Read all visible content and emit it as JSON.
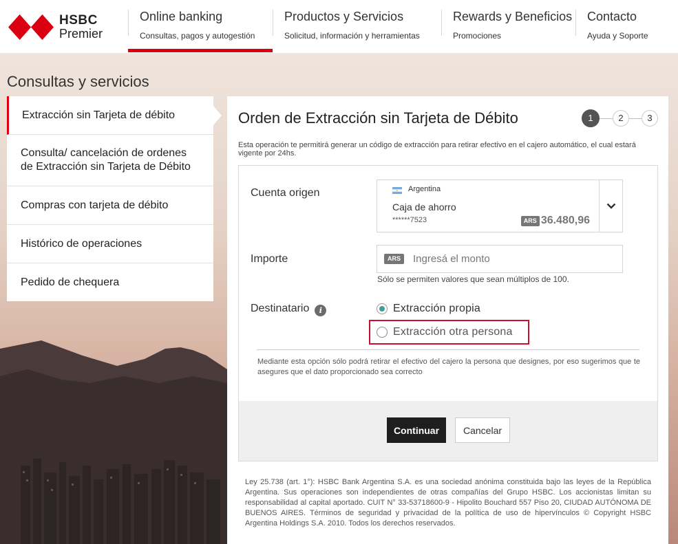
{
  "brand": {
    "name": "HSBC",
    "tier": "Premier"
  },
  "nav": [
    {
      "title": "Online banking",
      "subtitle": "Consultas, pagos y autogestión"
    },
    {
      "title": "Productos y Servicios",
      "subtitle": "Solicitud, información y herramientas"
    },
    {
      "title": "Rewards y Beneficios",
      "subtitle": "Promociones"
    },
    {
      "title": "Contacto",
      "subtitle": "Ayuda y Soporte"
    }
  ],
  "page_title": "Consultas y servicios",
  "sidebar": {
    "items": [
      {
        "label": "Extracción sin Tarjeta de débito"
      },
      {
        "label": "Consulta/ cancelación de ordenes de Extracción sin Tarjeta de Débito"
      },
      {
        "label": "Compras con tarjeta de débito"
      },
      {
        "label": "Histórico de operaciones"
      },
      {
        "label": "Pedido de chequera"
      }
    ]
  },
  "form": {
    "title": "Orden de Extracción sin Tarjeta de Débito",
    "steps": [
      "1",
      "2",
      "3"
    ],
    "intro": "Esta operación te permitirá generar un código de extracción para retirar efectivo en el cajero automático, el cual estará vigente por 24hs.",
    "account": {
      "label": "Cuenta origen",
      "country": "Argentina",
      "type": "Caja de ahorro",
      "number": "******7523",
      "currency": "ARS",
      "balance": "36.480,96"
    },
    "amount": {
      "label": "Importe",
      "currency": "ARS",
      "placeholder": "Ingresá el monto",
      "hint": "Sólo se permiten valores que sean múltiplos de 100."
    },
    "recipient": {
      "label": "Destinatario",
      "option_own": "Extracción propia",
      "option_other": "Extracción otra persona",
      "note": "Mediante esta opción sólo podrá retirar el efectivo del cajero la persona que designes, por eso sugerimos que te asegures que el dato proporcionado sea correcto"
    },
    "continue_label": "Continuar",
    "cancel_label": "Cancelar"
  },
  "legal": "Ley 25.738 (art. 1°): HSBC Bank Argentina S.A. es una sociedad anónima constituida bajo las leyes de la República Argentina. Sus operaciones son independientes de otras compañías del Grupo HSBC. Los accionistas limitan su responsabilidad al capital aportado. CUIT N° 33-53718600-9 - Hipolito Bouchard 557 Piso 20, CIUDAD AUTÓNOMA DE BUENOS AIRES. Términos de seguridad y privacidad de la política de uso de hipervínculos © Copyright HSBC Argentina Holdings S.A. 2010. Todos los derechos reservados.",
  "colors": {
    "accent": "#db0011",
    "highlight": "#c8102e",
    "radio_selected": "#3e9f9a",
    "primary_button": "#1e1e1e"
  }
}
